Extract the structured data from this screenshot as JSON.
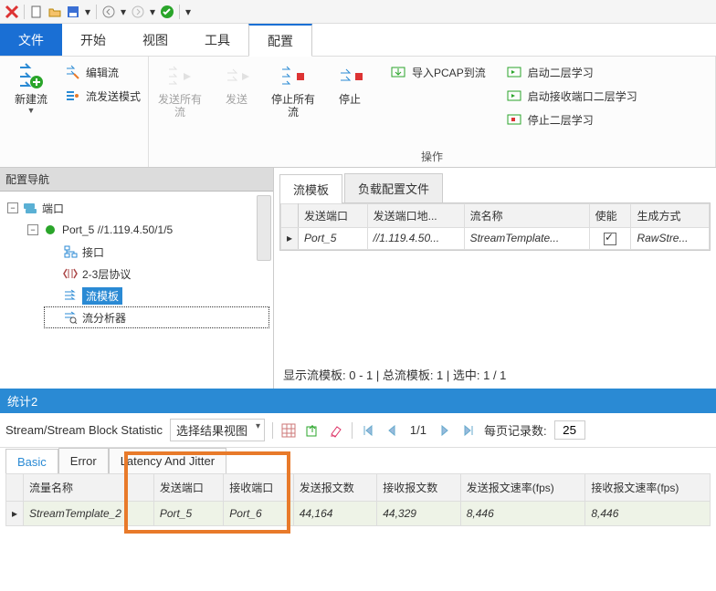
{
  "ribbon": {
    "tabs": {
      "file": "文件",
      "start": "开始",
      "view": "视图",
      "tools": "工具",
      "config": "配置"
    },
    "group1": {
      "new_stream": "新建流",
      "edit_stream": "编辑流",
      "stream_mode": "流发送模式"
    },
    "group2": {
      "send_all": "发送所有流",
      "send": "发送",
      "stop_all": "停止所有流",
      "stop": "停止",
      "import_pcap": "导入PCAP到流",
      "start_l2": "启动二层学习",
      "start_rx_l2": "启动接收端口二层学习",
      "stop_l2": "停止二层学习",
      "label": "操作"
    }
  },
  "nav": {
    "title": "配置导航",
    "port_root": "端口",
    "port_item": "Port_5 //1.119.4.50/1/5",
    "children": {
      "iface": "接口",
      "l23": "2-3层协议",
      "stream_tpl": "流模板",
      "analyzer": "流分析器"
    }
  },
  "top_tabs": {
    "stream_tpl": "流模板",
    "payload_cfg": "负载配置文件"
  },
  "grid1": {
    "headers": {
      "tx_port": "发送端口",
      "tx_addr": "发送端口地...",
      "stream_name": "流名称",
      "enable": "使能",
      "gen_mode": "生成方式"
    },
    "row": {
      "tx_port": "Port_5",
      "tx_addr": "//1.119.4.50...",
      "stream_name": "StreamTemplate...",
      "enable_checked": true,
      "gen_mode": "RawStre..."
    },
    "footer": "显示流模板:  0 - 1 | 总流模板: 1 | 选中: 1 / 1"
  },
  "stats": {
    "title": "统计2",
    "label": "Stream/Stream Block Statistic",
    "view_sel": "选择结果视图",
    "page": "1/1",
    "page_label": "每页记录数:",
    "page_size": "25",
    "tabs": {
      "basic": "Basic",
      "error": "Error",
      "latency": "Latency And Jitter"
    },
    "headers": {
      "name": "流量名称",
      "tx_port": "发送端口",
      "rx_port": "接收端口",
      "tx_pkts": "发送报文数",
      "rx_pkts": "接收报文数",
      "tx_fps": "发送报文速率(fps)",
      "rx_fps": "接收报文速率(fps)"
    },
    "row": {
      "name": "StreamTemplate_2",
      "tx_port": "Port_5",
      "rx_port": "Port_6",
      "tx_pkts": "44,164",
      "rx_pkts": "44,329",
      "tx_fps": "8,446",
      "rx_fps": "8,446"
    }
  }
}
